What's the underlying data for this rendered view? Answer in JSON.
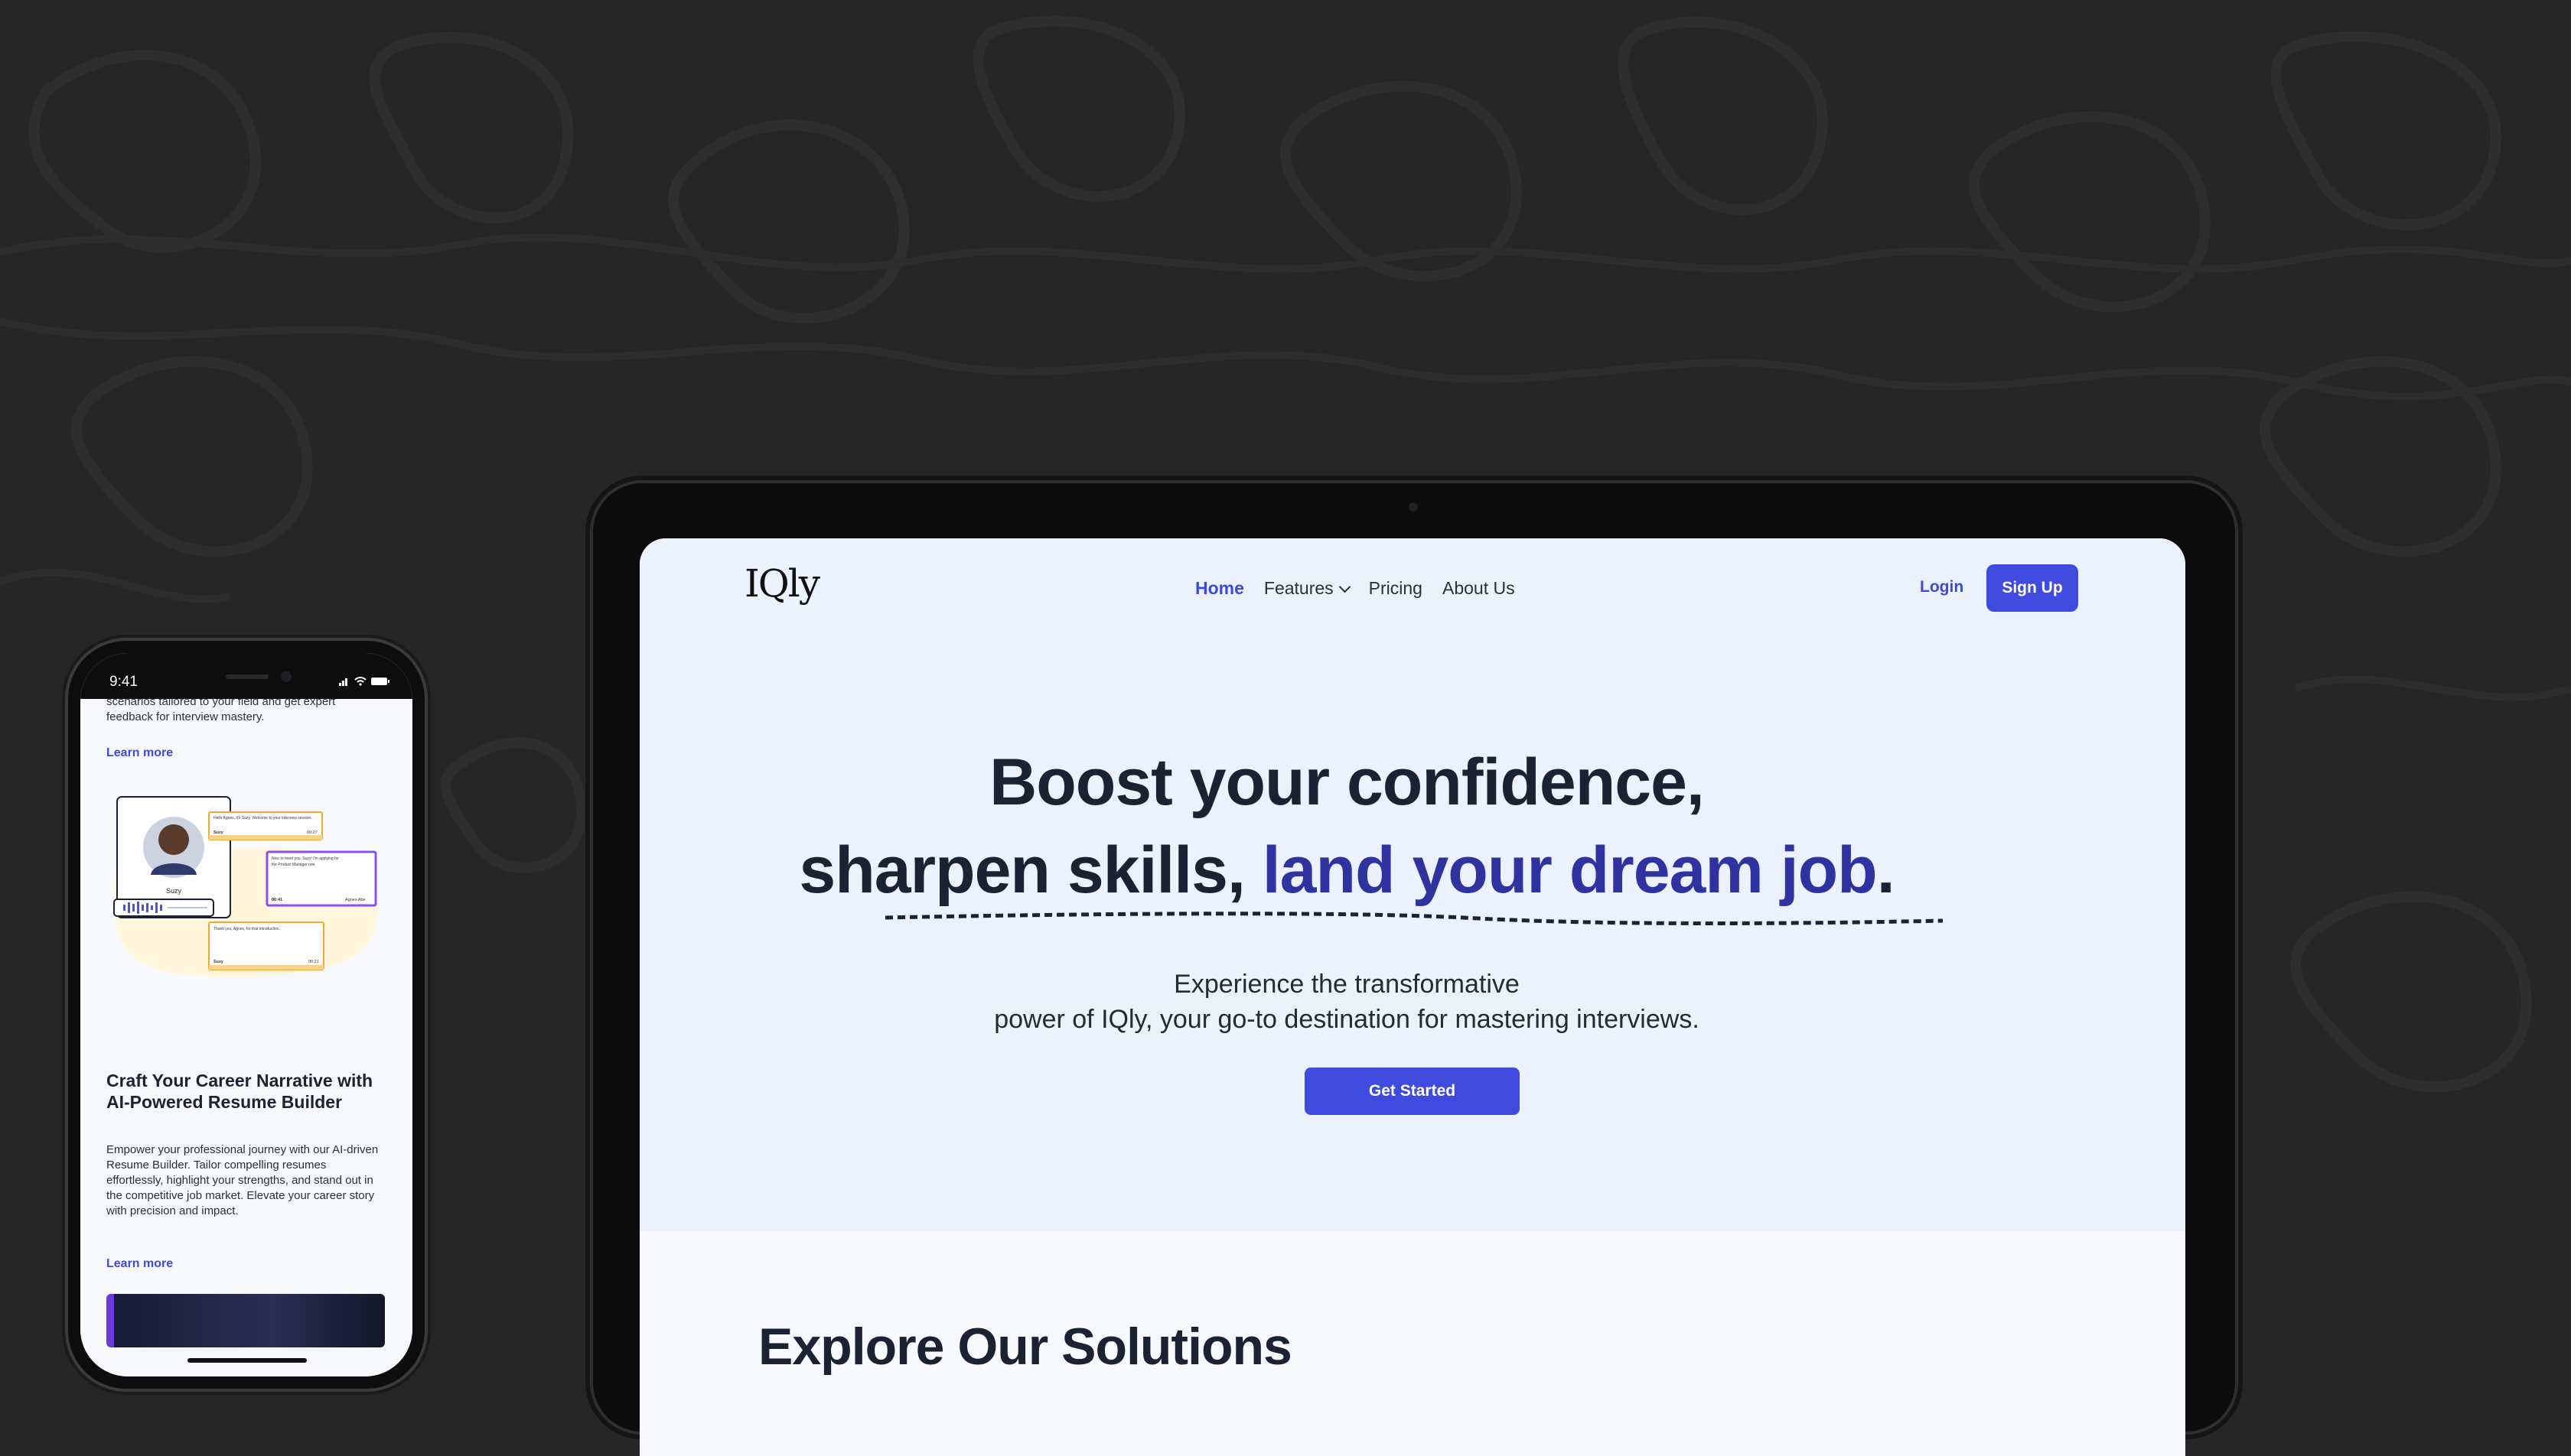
{
  "laptop": {
    "nav": {
      "logo": "IQly",
      "home": "Home",
      "features": "Features",
      "pricing": "Pricing",
      "about": "About Us",
      "login": "Login",
      "signup": "Sign Up"
    },
    "hero": {
      "line1": "Boost your confidence,",
      "line2_plain": "sharpen skills, ",
      "line2_accent": "land your dream job",
      "line2_end": ".",
      "sub_line1": "Experience the transformative",
      "sub_line2": "power of IQly, your go-to destination for mastering interviews.",
      "cta": "Get Started"
    },
    "section_title": "Explore Our Solutions"
  },
  "phone": {
    "time": "9:41",
    "top_text": "scenarios tailored to your field and get expert feedback for interview mastery.",
    "learn_more_1": "Learn more",
    "illustration": {
      "name": "Suzy",
      "bubble1": "Hello Agnes, it's Suzy. Welcome to your interview session. Kindly introduce yourself.",
      "bubble1_meta": "Suzy",
      "bubble1_time": "00:27",
      "bubble2": "Nice to meet you, Suzy! I'm applying for the Product Manager role. As a seasoned Product Manager, I bring a wealth of experience in crafting solutions that resonate with users. Here's to an exciting dialogue with impactful insights.",
      "bubble2_meta": "Agnes Abe",
      "bubble2_time": "00:41",
      "bubble3": "Thank you, Agnes, for that introduction. We're pleased to have someone with your expertise joining us today. To kick things off, could you share an example of how you successfully navigated challenges and prioritized customer outcomes?",
      "bubble3_meta": "Suzy",
      "bubble3_time": "00:21"
    },
    "card_title": "Craft Your Career Narrative with AI-Powered Resume Builder",
    "card_body": "Empower your professional journey with our AI-driven Resume Builder. Tailor compelling resumes effortlessly, highlight your strengths, and stand out in the competitive job market. Elevate your career story with precision and impact.",
    "learn_more_2": "Learn more"
  },
  "colors": {
    "accent": "#3f4bdf",
    "headline_accent": "#2e33a0",
    "hero_bg": "#ebf2fd",
    "page_bg": "#262626"
  }
}
